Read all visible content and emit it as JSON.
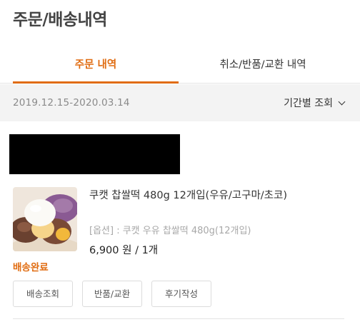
{
  "header": {
    "title": "주문/배송내역"
  },
  "tabs": [
    {
      "label": "주문 내역",
      "active": true
    },
    {
      "label": "취소/반품/교환 내역",
      "active": false
    }
  ],
  "filter": {
    "date_range": "2019.12.15-2020.03.14",
    "period_label": "기간별 조회",
    "icon": "chevron-down-icon"
  },
  "order": {
    "product_name": "쿠캣 찹쌀떡 480g 12개입(우유/고구마/초코)",
    "option": "[옵션] : 쿠캣 우유 찹쌀떡 480g(12개입)",
    "price": "6,900 원 / 1개",
    "status": "배송완료",
    "actions": {
      "track": "배송조회",
      "return": "반품/교환",
      "review": "후기작성"
    }
  },
  "colors": {
    "accent": "#e06c11",
    "filter_bg": "#f3f3f3",
    "muted_text": "#8a8a8a"
  }
}
